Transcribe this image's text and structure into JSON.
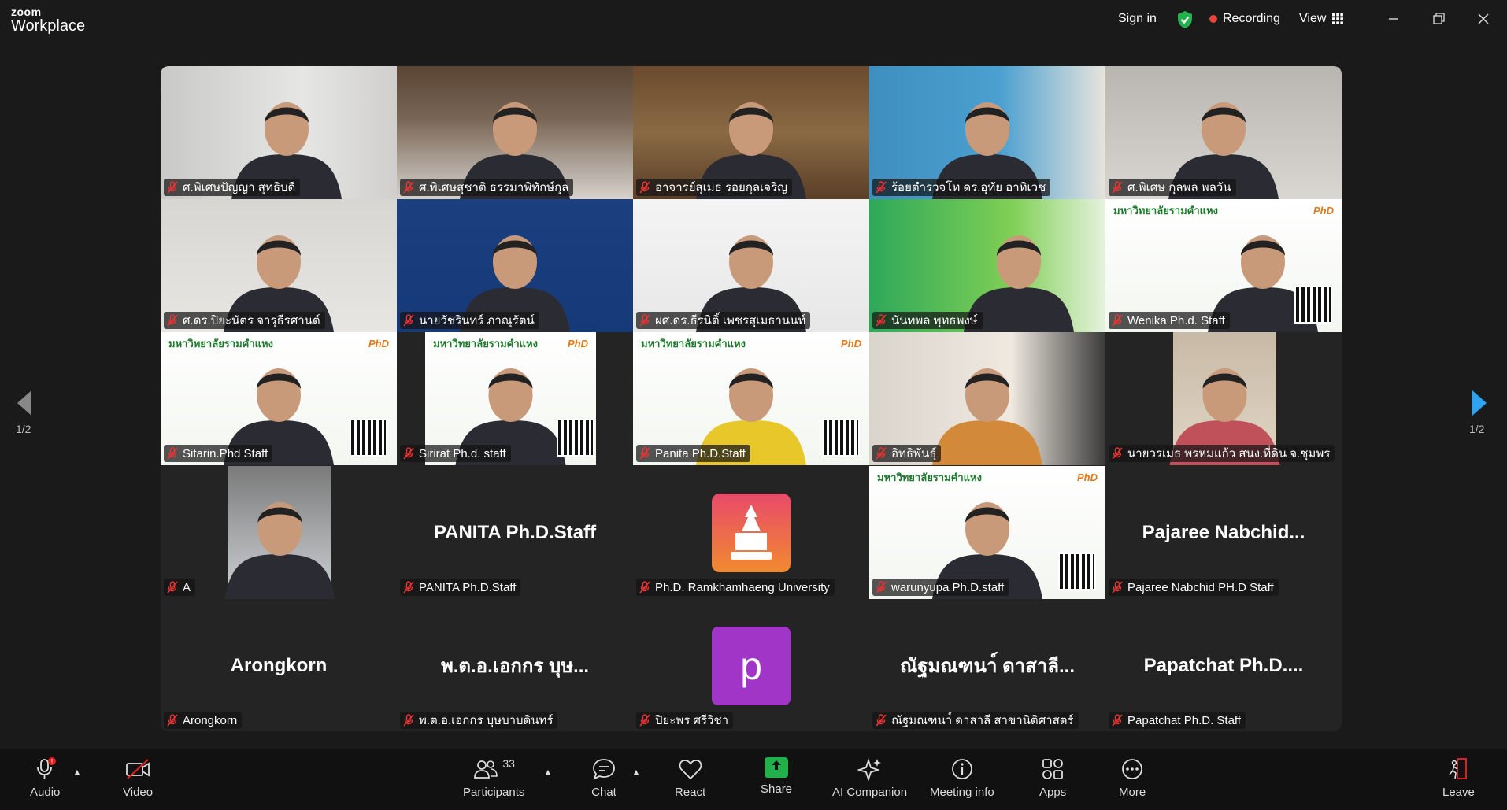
{
  "app": {
    "brand_small": "zoom",
    "brand_large": "Workplace"
  },
  "topbar": {
    "sign_in": "Sign in",
    "recording": "Recording",
    "view": "View"
  },
  "pager": {
    "left": "1/2",
    "right": "1/2"
  },
  "tiles": [
    {
      "name": "ศ.พิเศษปัญญา สุทธิบดี",
      "kind": "video"
    },
    {
      "name": "ศ.พิเศษสุชาติ ธรรมาพิทักษ์กุล",
      "kind": "video"
    },
    {
      "name": "อาจารย์สุเมธ รอยกุลเจริญ",
      "kind": "video",
      "active": true
    },
    {
      "name": "ร้อยตำรวจโท ดร.อุทัย  อาทิเวช",
      "kind": "video"
    },
    {
      "name": "ศ.พิเศษ กุลพล พลวัน",
      "kind": "video"
    },
    {
      "name": "ศ.ดร.ปิยะนัตร จารุธีรศานต์",
      "kind": "video"
    },
    {
      "name": "นายวัชรินทร์ ภาณุรัตน์",
      "kind": "video"
    },
    {
      "name": "ผศ.ดร.ธีรนิติ์ เพชรสุเมธานนท์",
      "kind": "video"
    },
    {
      "name": "นันทพล พุทธพงษ์",
      "kind": "video"
    },
    {
      "name": "Wenika Ph.d. Staff",
      "kind": "video"
    },
    {
      "name": "Sitarin.Phd Staff",
      "kind": "video"
    },
    {
      "name": "Sirirat Ph.d. staff",
      "kind": "video"
    },
    {
      "name": "Panita Ph.D.Staff",
      "kind": "video"
    },
    {
      "name": "อิทธิพันธุ์",
      "kind": "video"
    },
    {
      "name": "นายวรเมธ  พรหมแก้ว  สนง.ที่ดิน จ.ชุมพร",
      "kind": "video"
    },
    {
      "name": "A",
      "kind": "video"
    },
    {
      "name": "PANITA Ph.D.Staff",
      "kind": "name",
      "display": "PANITA Ph.D.Staff"
    },
    {
      "name": "Ph.D. Ramkhamhaeng University",
      "kind": "logo"
    },
    {
      "name": "warunyupa Ph.D.staff",
      "kind": "video"
    },
    {
      "name": "Pajaree Nabchid PH.D Staff",
      "kind": "name",
      "display": "Pajaree  Nabchid..."
    },
    {
      "name": "Arongkorn",
      "kind": "name",
      "display": "Arongkorn"
    },
    {
      "name": "พ.ต.อ.เอกกร บุษบาบดินทร์",
      "kind": "name",
      "display": "พ.ต.อ.เอกกร บุษ..."
    },
    {
      "name": "ปิยะพร ศรีวิชา",
      "kind": "avatar",
      "letter": "p"
    },
    {
      "name": "ณัฐมณฑนา์ ดาสาลี สาขานิติศาสตร์",
      "kind": "name",
      "display": "ณัฐมณฑนา์ ดาสาลี..."
    },
    {
      "name": "Papatchat Ph.D. Staff",
      "kind": "name",
      "display": "Papatchat  Ph.D...."
    }
  ],
  "slide_text": {
    "uni": "มหาวิทยาลัยรามคำแหง",
    "phd": "PhD"
  },
  "bottombar": {
    "audio": "Audio",
    "video": "Video",
    "participants": "Participants",
    "participants_count": "33",
    "chat": "Chat",
    "react": "React",
    "share": "Share",
    "ai": "AI Companion",
    "meeting_info": "Meeting info",
    "apps": "Apps",
    "more": "More",
    "leave": "Leave"
  },
  "colors": {
    "active_border": "#2ecc71",
    "recording": "#e8443a",
    "share": "#21b04b",
    "avatar_purple": "#a035c8"
  }
}
